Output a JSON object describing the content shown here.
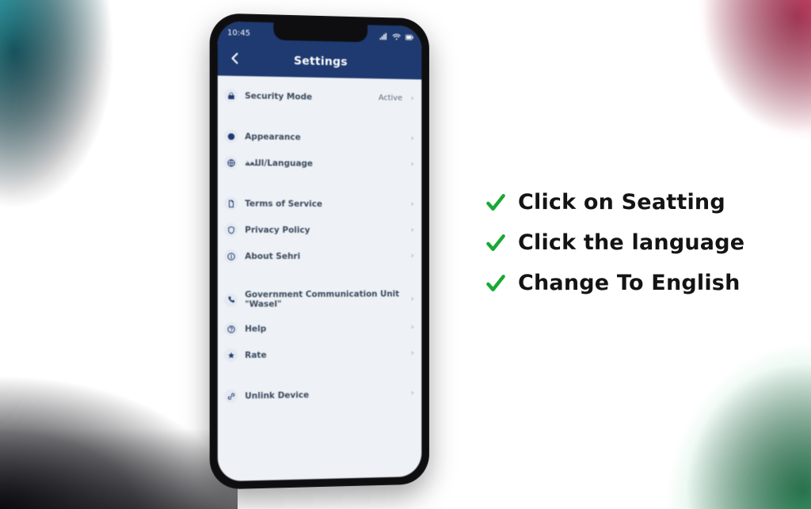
{
  "statusbar": {
    "time": "10:45"
  },
  "titlebar": {
    "title": "Settings"
  },
  "settings": {
    "groups": [
      {
        "rows": [
          {
            "icon": "lock-icon",
            "label": "Security Mode",
            "value": "Active"
          }
        ]
      },
      {
        "rows": [
          {
            "icon": "palette-icon",
            "label": "Appearance",
            "value": ""
          },
          {
            "icon": "globe-icon",
            "label": "اللغة/Language",
            "value": ""
          }
        ]
      },
      {
        "rows": [
          {
            "icon": "doc-icon",
            "label": "Terms of Service",
            "value": ""
          },
          {
            "icon": "shield-icon",
            "label": "Privacy Policy",
            "value": ""
          },
          {
            "icon": "info-icon",
            "label": "About Sehri",
            "value": ""
          }
        ]
      },
      {
        "rows": [
          {
            "icon": "phone-icon",
            "label": "Government Communication Unit \"Wasel\"",
            "value": ""
          },
          {
            "icon": "help-icon",
            "label": "Help",
            "value": ""
          },
          {
            "icon": "star-icon",
            "label": "Rate",
            "value": ""
          }
        ]
      },
      {
        "rows": [
          {
            "icon": "unlink-icon",
            "label": "Unlink Device",
            "value": ""
          }
        ]
      }
    ]
  },
  "steps": {
    "items": [
      "Click on Seatting",
      "Click the language",
      "Change To English"
    ]
  },
  "colors": {
    "header": "#1e3a70",
    "checkmark": "#18a934"
  }
}
